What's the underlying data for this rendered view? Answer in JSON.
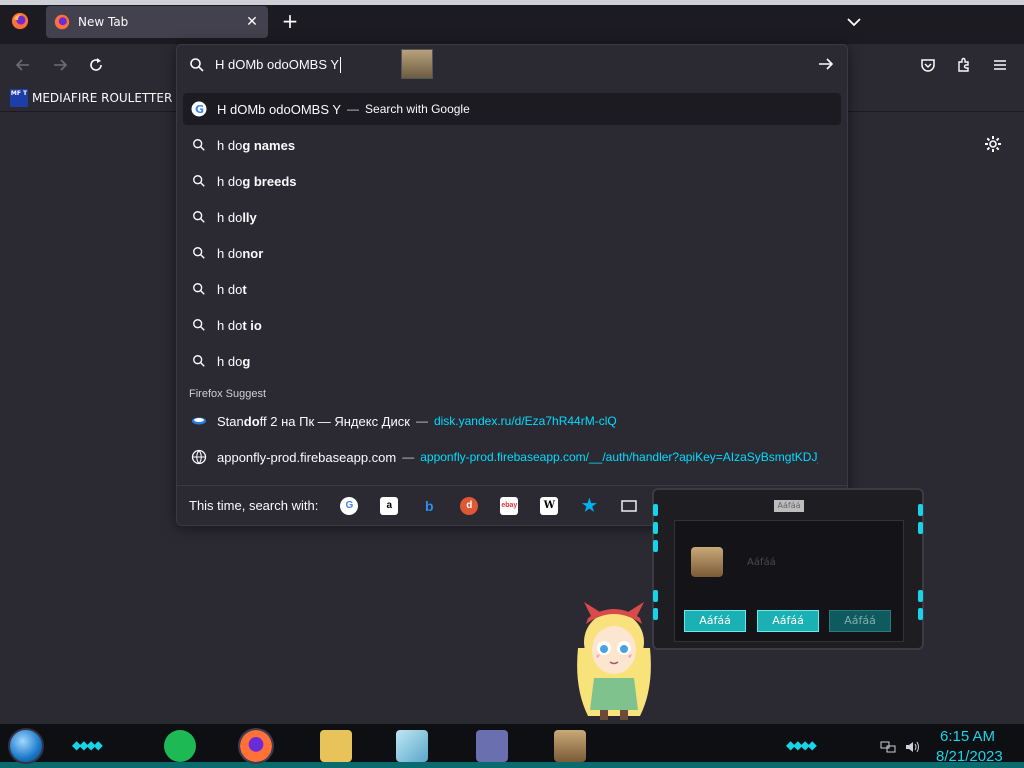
{
  "browser": {
    "tab": {
      "title": "New Tab"
    },
    "bookmarks": [
      {
        "label": "MEDIAFIRE ROULETTER",
        "icon_text": "MF T"
      }
    ]
  },
  "urlbar": {
    "input_value": "H dOMb odoOMBS Y",
    "heuristic": {
      "text": "H dOMb odoOMBS Y",
      "action": "Search with Google"
    },
    "suggestions": [
      {
        "prefix": "h do",
        "bold": "g names"
      },
      {
        "prefix": "h do",
        "bold": "g breeds"
      },
      {
        "prefix": "h do",
        "bold": "lly"
      },
      {
        "prefix": "h do",
        "bold": "nor"
      },
      {
        "prefix": "h do",
        "bold": "t"
      },
      {
        "prefix": "h do",
        "bold": "t io"
      },
      {
        "prefix": "h do",
        "bold": "g"
      }
    ],
    "group_label": "Firefox Suggest",
    "history": [
      {
        "title_pre": "Stan",
        "title_bold": "do",
        "title_post": "ff 2 на Пк — Яндекс Диск",
        "url": "disk.yandex.ru/d/Eza7hR44rM-clQ"
      },
      {
        "title_pre": "apponfly-prod.firebaseapp.com",
        "title_bold": "",
        "title_post": "",
        "url": "apponfly-prod.firebaseapp.com/__/auth/handler?apiKey=AIzaSyBsmgtKDJ_"
      }
    ],
    "oneoff_label": "This time, search with:",
    "engines": [
      "google",
      "amazon",
      "bing",
      "duckduckgo",
      "ebay",
      "wikipedia",
      "bookmarks",
      "tabs"
    ]
  },
  "gadget": {
    "title": "Aáfáá",
    "name": "Aáfáá",
    "buttons": [
      "Aáfáá",
      "Aáfáá",
      "Aáfáá"
    ]
  },
  "taskbar": {
    "time": "6:15 AM",
    "date": "8/21/2023"
  }
}
